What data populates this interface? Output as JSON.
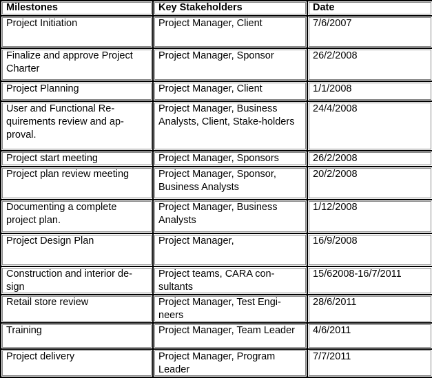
{
  "table": {
    "headers": [
      "Milestones",
      "Key Stakeholders",
      "Date"
    ],
    "rows": [
      {
        "milestone": "Project Initiation",
        "stakeholders": "Project Manager, Client",
        "date": "7/6/2007"
      },
      {
        "milestone": "Finalize and approve Project Charter",
        "stakeholders": "Project Manager, Sponsor",
        "date": "26/2/2008"
      },
      {
        "milestone": "Project Planning",
        "stakeholders": "Project Manager, Client",
        "date": "1/1/2008"
      },
      {
        "milestone": "User and Functional   Re-quirements review and ap-proval.",
        "stakeholders": "Project Manager, Business Analysts, Client, Stake-holders",
        "date": "24/4/2008"
      },
      {
        "milestone": "Project start meeting",
        "stakeholders": "Project Manager, Sponsors",
        "date": "26/2/2008"
      },
      {
        "milestone": "Project plan review meeting",
        "stakeholders": "Project Manager, Sponsor, Business Analysts",
        "date": "20/2/2008"
      },
      {
        "milestone": "Documenting a complete project plan.",
        "stakeholders": "Project Manager, Business Analysts",
        "date": "1/12/2008"
      },
      {
        "milestone": "Project Design Plan",
        "stakeholders": "Project Manager,",
        "date": "16/9/2008"
      },
      {
        "milestone": "Construction and interior de-sign",
        "stakeholders": "Project teams, CARA con-sultants",
        "date": "15/62008-16/7/2011"
      },
      {
        "milestone": "Retail store review",
        "stakeholders": "Project Manager, Test Engi-neers",
        "date": "28/6/2011"
      },
      {
        "milestone": "Training",
        "stakeholders": "Project Manager, Team Leader",
        "date": "4/6/2011"
      },
      {
        "milestone": "Project delivery",
        "stakeholders": "Project Manager, Program Leader",
        "date": "7/7/2011"
      }
    ]
  }
}
